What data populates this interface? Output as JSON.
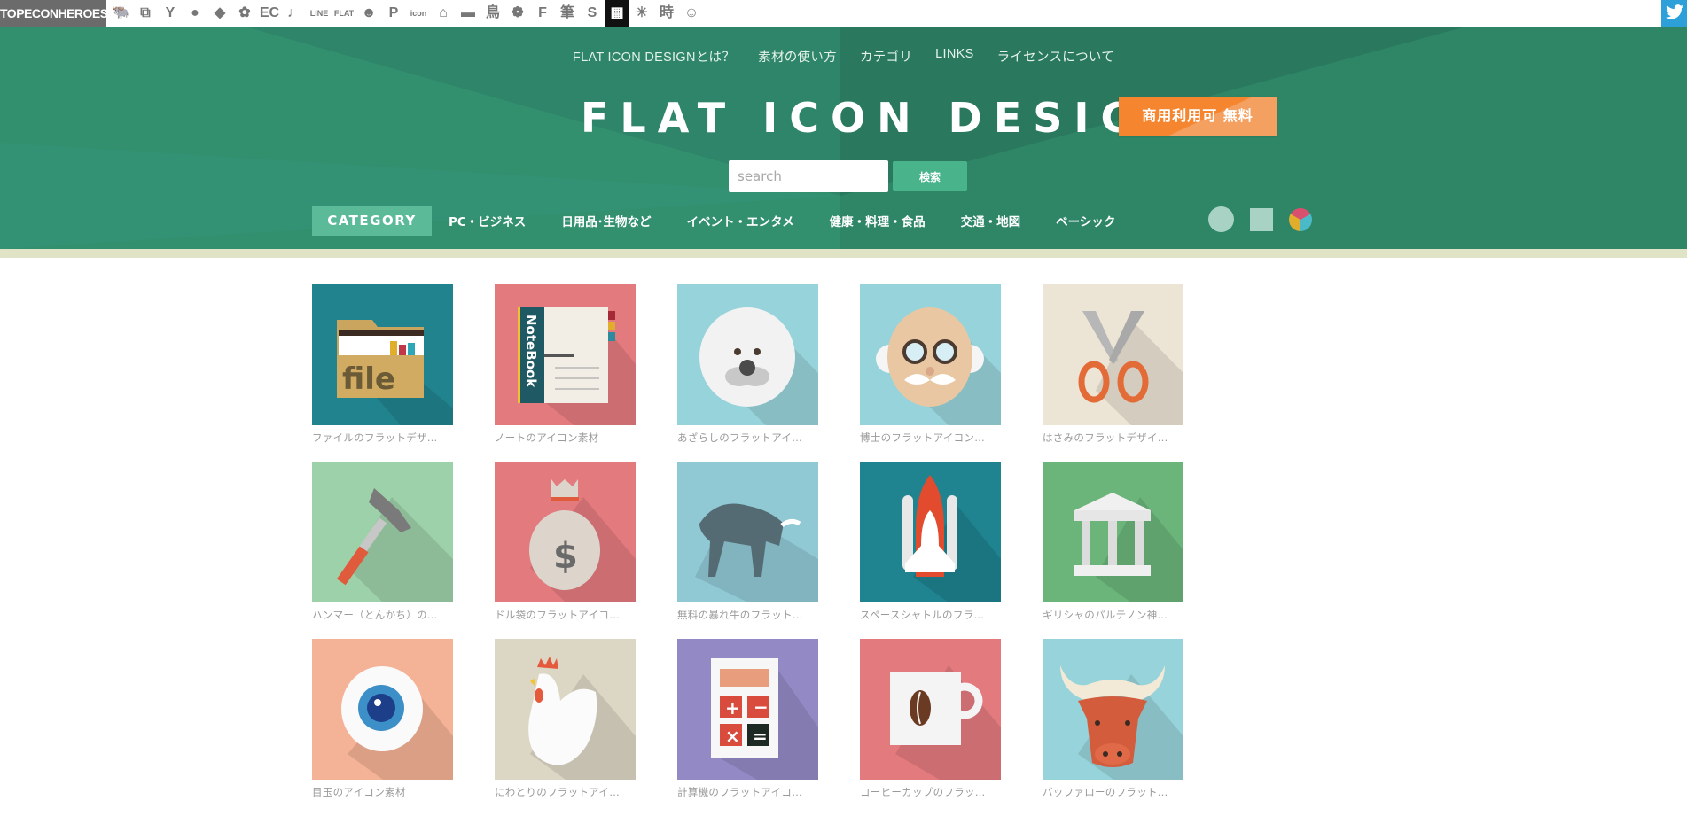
{
  "topbar": {
    "brand": "TOPECONHEROES",
    "icons": [
      {
        "name": "animal-silhouette-icon",
        "glyph": "🐃"
      },
      {
        "name": "overlap-squares-icon",
        "glyph": "⧉"
      },
      {
        "name": "person-cheer-icon",
        "glyph": "Y"
      },
      {
        "name": "speech-bubble-icon",
        "glyph": "●"
      },
      {
        "name": "cube-icon",
        "glyph": "◆"
      },
      {
        "name": "flower-icon",
        "glyph": "✿"
      },
      {
        "name": "ec-icon",
        "glyph": "EC"
      },
      {
        "name": "music-note-icon",
        "glyph": "♩"
      },
      {
        "name": "line-icon",
        "glyph": "LINE"
      },
      {
        "name": "flat-icon",
        "glyph": "FLAT"
      },
      {
        "name": "smiley-icon",
        "glyph": "☻"
      },
      {
        "name": "p-icon",
        "glyph": "P"
      },
      {
        "name": "icon-on-icon",
        "glyph": "icon"
      },
      {
        "name": "building-icon",
        "glyph": "⌂"
      },
      {
        "name": "sofa-icon",
        "glyph": "▬"
      },
      {
        "name": "bird-kanji-icon",
        "glyph": "鳥"
      },
      {
        "name": "pattern-circle-icon",
        "glyph": "❁"
      },
      {
        "name": "f-logo-icon",
        "glyph": "F"
      },
      {
        "name": "brush-kanji-icon",
        "glyph": "筆"
      },
      {
        "name": "s-logo-icon",
        "glyph": "S"
      },
      {
        "name": "grid-icon",
        "glyph": "▦"
      },
      {
        "name": "burst-icon",
        "glyph": "✳"
      },
      {
        "name": "time-kanji-icon",
        "glyph": "時"
      },
      {
        "name": "face-icon",
        "glyph": "☺"
      }
    ],
    "twitter_icon": "twitter-icon"
  },
  "header": {
    "nav": [
      "FLAT ICON DESIGNとは？",
      "素材の使い方",
      "カテゴリ",
      "LINKS",
      "ライセンスについて"
    ],
    "title": "FLAT ICON DESIGN",
    "badge": "商用利用可 無料",
    "search": {
      "placeholder": "search",
      "value": "",
      "button": "検索"
    },
    "category_label": "CATEGORY",
    "categories": [
      "PC・ビジネス",
      "日用品･生物など",
      "イベント・エンタメ",
      "健康・料理・食品",
      "交通・地図",
      "ベーシック"
    ],
    "shape_filters": [
      {
        "name": "circle-filter-button",
        "color": "#a8d3c4"
      },
      {
        "name": "square-filter-button",
        "color": "#a8d3c4"
      },
      {
        "name": "multicolor-filter-button",
        "colors": [
          "#d94f6e",
          "#4bbac8",
          "#e0ad2c"
        ]
      }
    ]
  },
  "colors": {
    "hero_bg": "#32906f",
    "hero_dark": "#2b7d60",
    "badge": "#f5862f",
    "search_button": "#49b38c",
    "category_label_bg": "#5bbb98",
    "stripe": "#e0e3c6",
    "caption_text": "#9a9a9a"
  },
  "icons": [
    {
      "caption": "ファイルのフラットデザ…",
      "subject": "folder-file",
      "bg": "#20838e"
    },
    {
      "caption": "ノートのアイコン素材",
      "subject": "notebook",
      "bg": "#e27a7e"
    },
    {
      "caption": "あざらしのフラットアイ…",
      "subject": "seal",
      "bg": "#97d3da"
    },
    {
      "caption": "博士のフラットアイコン…",
      "subject": "professor",
      "bg": "#97d3da"
    },
    {
      "caption": "はさみのフラットデザイ…",
      "subject": "scissors",
      "bg": "#ece4d4"
    },
    {
      "caption": "ハンマー（とんかち）の…",
      "subject": "hammer",
      "bg": "#9dd1a9"
    },
    {
      "caption": "ドル袋のフラットアイコ…",
      "subject": "money-bag",
      "bg": "#e27a7e"
    },
    {
      "caption": "無料の暴れ牛のフラット…",
      "subject": "bull",
      "bg": "#90c9d4"
    },
    {
      "caption": "スペースシャトルのフラ…",
      "subject": "space-shuttle",
      "bg": "#1f8390"
    },
    {
      "caption": "ギリシャのパルテノン神…",
      "subject": "parthenon",
      "bg": "#6bb57a"
    },
    {
      "caption": "目玉のアイコン素材",
      "subject": "eyeball",
      "bg": "#f4b296"
    },
    {
      "caption": "にわとりのフラットアイ…",
      "subject": "chicken",
      "bg": "#dcd6c4"
    },
    {
      "caption": "計算機のフラットアイコ…",
      "subject": "calculator",
      "bg": "#9389c4"
    },
    {
      "caption": "コーヒーカップのフラッ…",
      "subject": "coffee-cup",
      "bg": "#e27a7e"
    },
    {
      "caption": "バッファローのフラット…",
      "subject": "buffalo",
      "bg": "#97d3da"
    }
  ]
}
